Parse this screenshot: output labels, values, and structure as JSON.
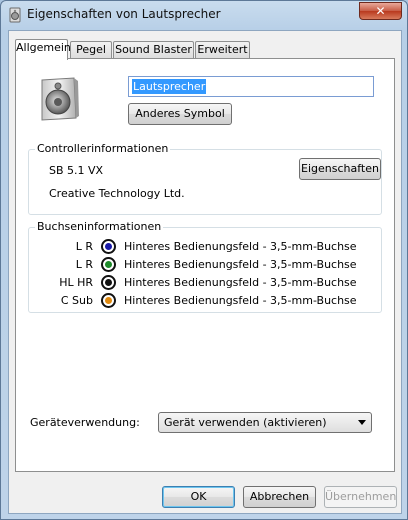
{
  "window": {
    "title": "Eigenschaften von Lautsprecher",
    "close_label": "✕"
  },
  "tabs": [
    {
      "label": "Allgemein",
      "active": true
    },
    {
      "label": "Pegel"
    },
    {
      "label": "Sound Blaster"
    },
    {
      "label": "Erweitert"
    }
  ],
  "general": {
    "device_name": "Lautsprecher",
    "change_icon_label": "Anderes Symbol"
  },
  "controller": {
    "group_title": "Controllerinformationen",
    "model": "SB 5.1 VX",
    "manufacturer": "Creative Technology Ltd.",
    "properties_label": "Eigenschaften"
  },
  "jacks": {
    "group_title": "Buchseninformationen",
    "rows": [
      {
        "label": "L R",
        "color": "#1a1aa8",
        "description": "Hinteres Bedienungsfeld - 3,5-mm-Buchse"
      },
      {
        "label": "L R",
        "color": "#1e8a2a",
        "description": "Hinteres Bedienungsfeld - 3,5-mm-Buchse"
      },
      {
        "label": "HL HR",
        "color": "#111111",
        "description": "Hinteres Bedienungsfeld - 3,5-mm-Buchse"
      },
      {
        "label": "C Sub",
        "color": "#e08a10",
        "description": "Hinteres Bedienungsfeld - 3,5-mm-Buchse"
      }
    ]
  },
  "usage": {
    "label": "Geräteverwendung:",
    "selected": "Gerät verwenden (aktivieren)"
  },
  "footer": {
    "ok_label": "OK",
    "cancel_label": "Abbrechen",
    "apply_label": "Übernehmen"
  }
}
